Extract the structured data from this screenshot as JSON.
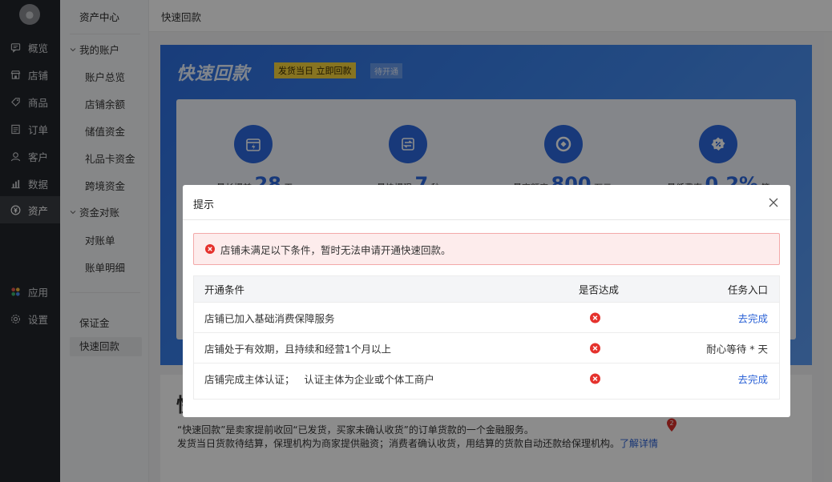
{
  "nav": {
    "items": [
      {
        "label": "概览",
        "icon": "chat-icon"
      },
      {
        "label": "店铺",
        "icon": "store-icon"
      },
      {
        "label": "商品",
        "icon": "tag-icon"
      },
      {
        "label": "订单",
        "icon": "document-icon"
      },
      {
        "label": "客户",
        "icon": "user-icon"
      },
      {
        "label": "数据",
        "icon": "chart-icon"
      },
      {
        "label": "资产",
        "icon": "yuan-icon",
        "active": true
      },
      {
        "label": "应用",
        "icon": "apps-icon"
      },
      {
        "label": "设置",
        "icon": "gear-icon"
      }
    ]
  },
  "sidebar": {
    "header": "资产中心",
    "group1": "我的账户",
    "group1_items": [
      "账户总览",
      "店铺余额",
      "储值资金",
      "礼品卡资金",
      "跨境资金"
    ],
    "group2": "资金对账",
    "group2_items": [
      "对账单",
      "账单明细"
    ],
    "items": [
      "保证金",
      "快速回款"
    ]
  },
  "topbar": {
    "title": "快速回款"
  },
  "banner": {
    "brand": "快速回款",
    "tag": "发货当日 立即回款",
    "status": "待开通",
    "features": [
      {
        "prefix": "最长提前",
        "value": "28",
        "unit": "天"
      },
      {
        "prefix": "最快提现",
        "value": "7",
        "unit": "秒"
      },
      {
        "prefix": "最高额度",
        "value": "800",
        "unit": "万元"
      },
      {
        "prefix": "最低费率",
        "value": "0.2%",
        "unit": "笔"
      }
    ]
  },
  "intro": {
    "line1": "“快速回款”是卖家提前收回“已发货，买家未确认收货”的订单货款的一个金融服务。",
    "line2": "发货当日货款待结算，保理机构为商家提供融资；消费者确认收货，用结算的货款自动还款给保理机构。",
    "link": "了解详情",
    "pin_number": "2"
  },
  "modal": {
    "title": "提示",
    "alert": "店铺未满足以下条件，暂时无法申请开通快速回款。",
    "columns": [
      "开通条件",
      "是否达成",
      "任务入口"
    ],
    "rows": [
      {
        "condition": "店铺已加入基础消费保障服务",
        "action": "去完成",
        "is_link": true
      },
      {
        "condition": "店铺处于有效期，且持续和经营1个月以上",
        "action": "耐心等待 * 天",
        "is_link": false
      },
      {
        "condition": "店铺完成主体认证；   认证主体为企业或个体工商户",
        "action": "去完成",
        "is_link": true
      }
    ]
  }
}
